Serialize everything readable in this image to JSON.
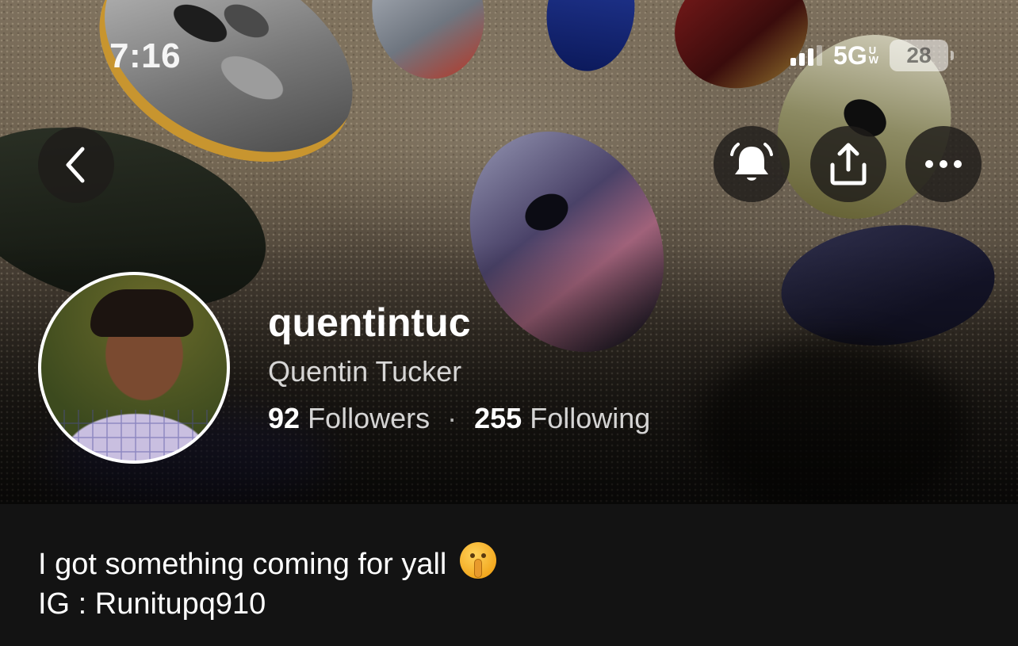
{
  "status_bar": {
    "time": "7:16",
    "network": "5G",
    "network_sub_top": "U",
    "network_sub_bottom": "W",
    "battery": "28"
  },
  "profile": {
    "username": "quentintuc",
    "display_name": "Quentin Tucker",
    "followers_count": "92",
    "followers_label": "Followers",
    "separator": "·",
    "following_count": "255",
    "following_label": "Following"
  },
  "bio": {
    "line1": "I got something coming for yall",
    "line2": "IG : Runitupq910"
  },
  "icons": {
    "back": "chevron-left-icon",
    "notify": "bell-icon",
    "share": "share-icon",
    "more": "more-icon",
    "emoji": "shushing-face-icon"
  },
  "colors": {
    "background": "#131313",
    "text_primary": "#ffffff",
    "text_secondary": "#d1d1d1",
    "button_bg": "#1e1c1a"
  }
}
